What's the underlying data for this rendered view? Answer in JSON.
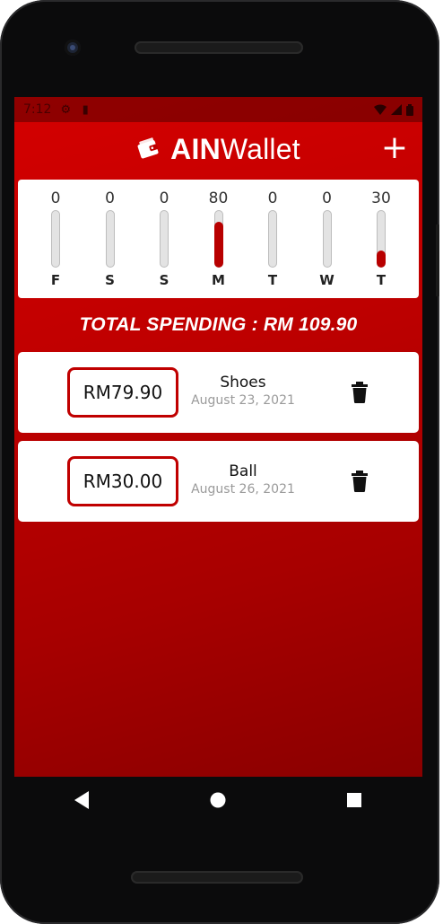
{
  "status_bar": {
    "time": "7:12",
    "icons_left": [
      "gear-icon",
      "sd-card-icon"
    ],
    "icons_right": [
      "wifi-icon",
      "signal-icon",
      "battery-icon"
    ]
  },
  "app_bar": {
    "brand_bold": "AIN",
    "brand_regular": "Wallet",
    "add_label": "+"
  },
  "chart_data": {
    "type": "bar",
    "categories": [
      "F",
      "S",
      "S",
      "M",
      "T",
      "W",
      "T"
    ],
    "values": [
      0,
      0,
      0,
      80,
      0,
      0,
      30
    ],
    "ylim": [
      0,
      100
    ],
    "colors": {
      "fill": "#b80000",
      "track": "#e3e3e3"
    }
  },
  "total_spending": "TOTAL SPENDING : RM 109.90",
  "transactions": [
    {
      "amount": "RM79.90",
      "title": "Shoes",
      "date": "August 23, 2021"
    },
    {
      "amount": "RM30.00",
      "title": "Ball",
      "date": "August 26, 2021"
    }
  ],
  "colors": {
    "accent": "#c00000",
    "background_top": "#d40000",
    "background_bottom": "#8a0000"
  }
}
